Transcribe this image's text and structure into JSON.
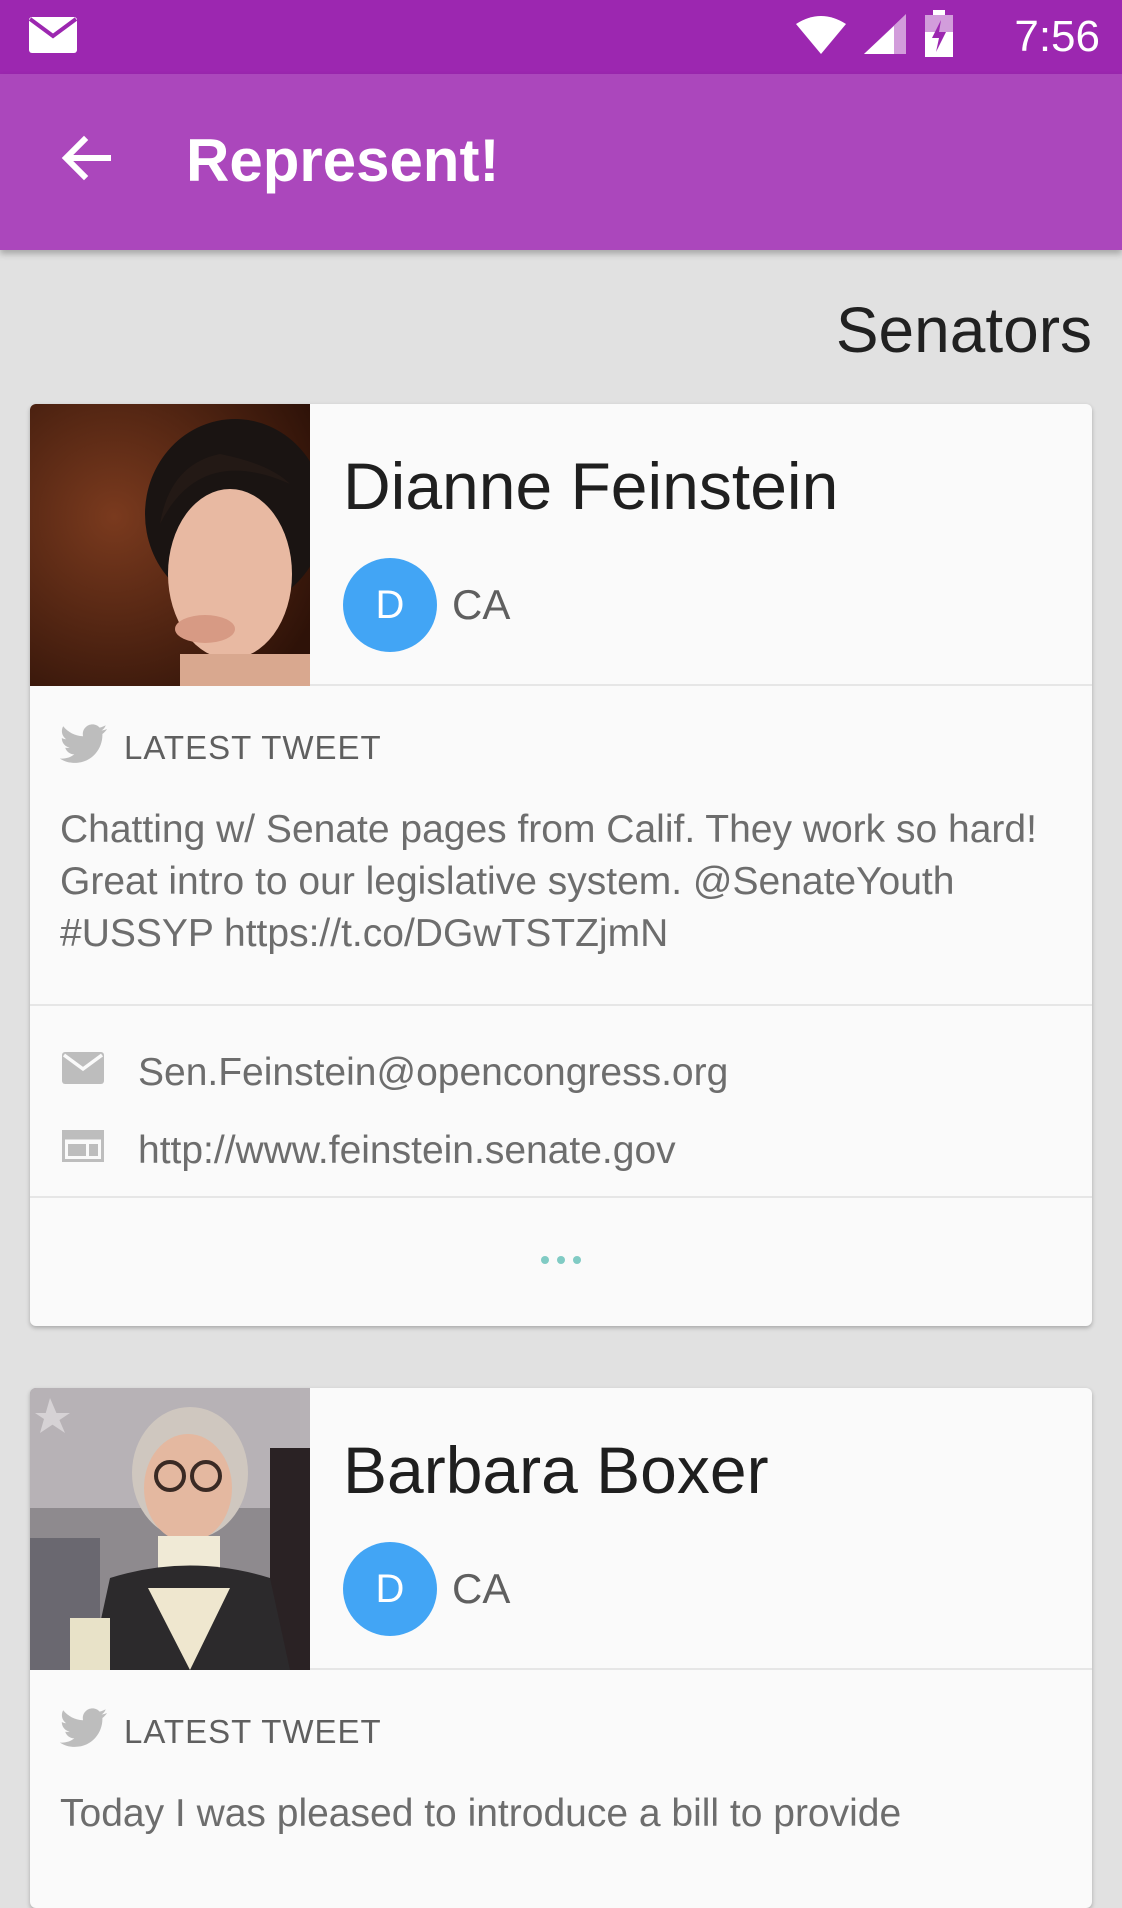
{
  "status_bar": {
    "time": "7:56",
    "icons": [
      "mail-icon",
      "wifi-icon",
      "signal-icon",
      "battery-charging-icon"
    ]
  },
  "app_bar": {
    "title": "Represent!",
    "back_icon": "arrow-left-icon"
  },
  "section": {
    "title": "Senators"
  },
  "colors": {
    "status_bar": "#9c27b0",
    "app_bar": "#ab47bc",
    "party_badge": "#42a5f5",
    "more_dots": "#80cbc4"
  },
  "cards": [
    {
      "name": "Dianne Feinstein",
      "party": "D",
      "state": "CA",
      "tweet_label": "LATEST TWEET",
      "tweet": "Chatting w/ Senate pages from Calif. They work so hard! Great intro to our legislative system. @SenateYouth #USSYP https://t.co/DGwTSTZjmN",
      "email": "Sen.Feinstein@opencongress.org",
      "website": "http://www.feinstein.senate.gov"
    },
    {
      "name": "Barbara Boxer",
      "party": "D",
      "state": "CA",
      "tweet_label": "LATEST TWEET",
      "tweet": "Today I was pleased to introduce a bill to provide"
    }
  ]
}
